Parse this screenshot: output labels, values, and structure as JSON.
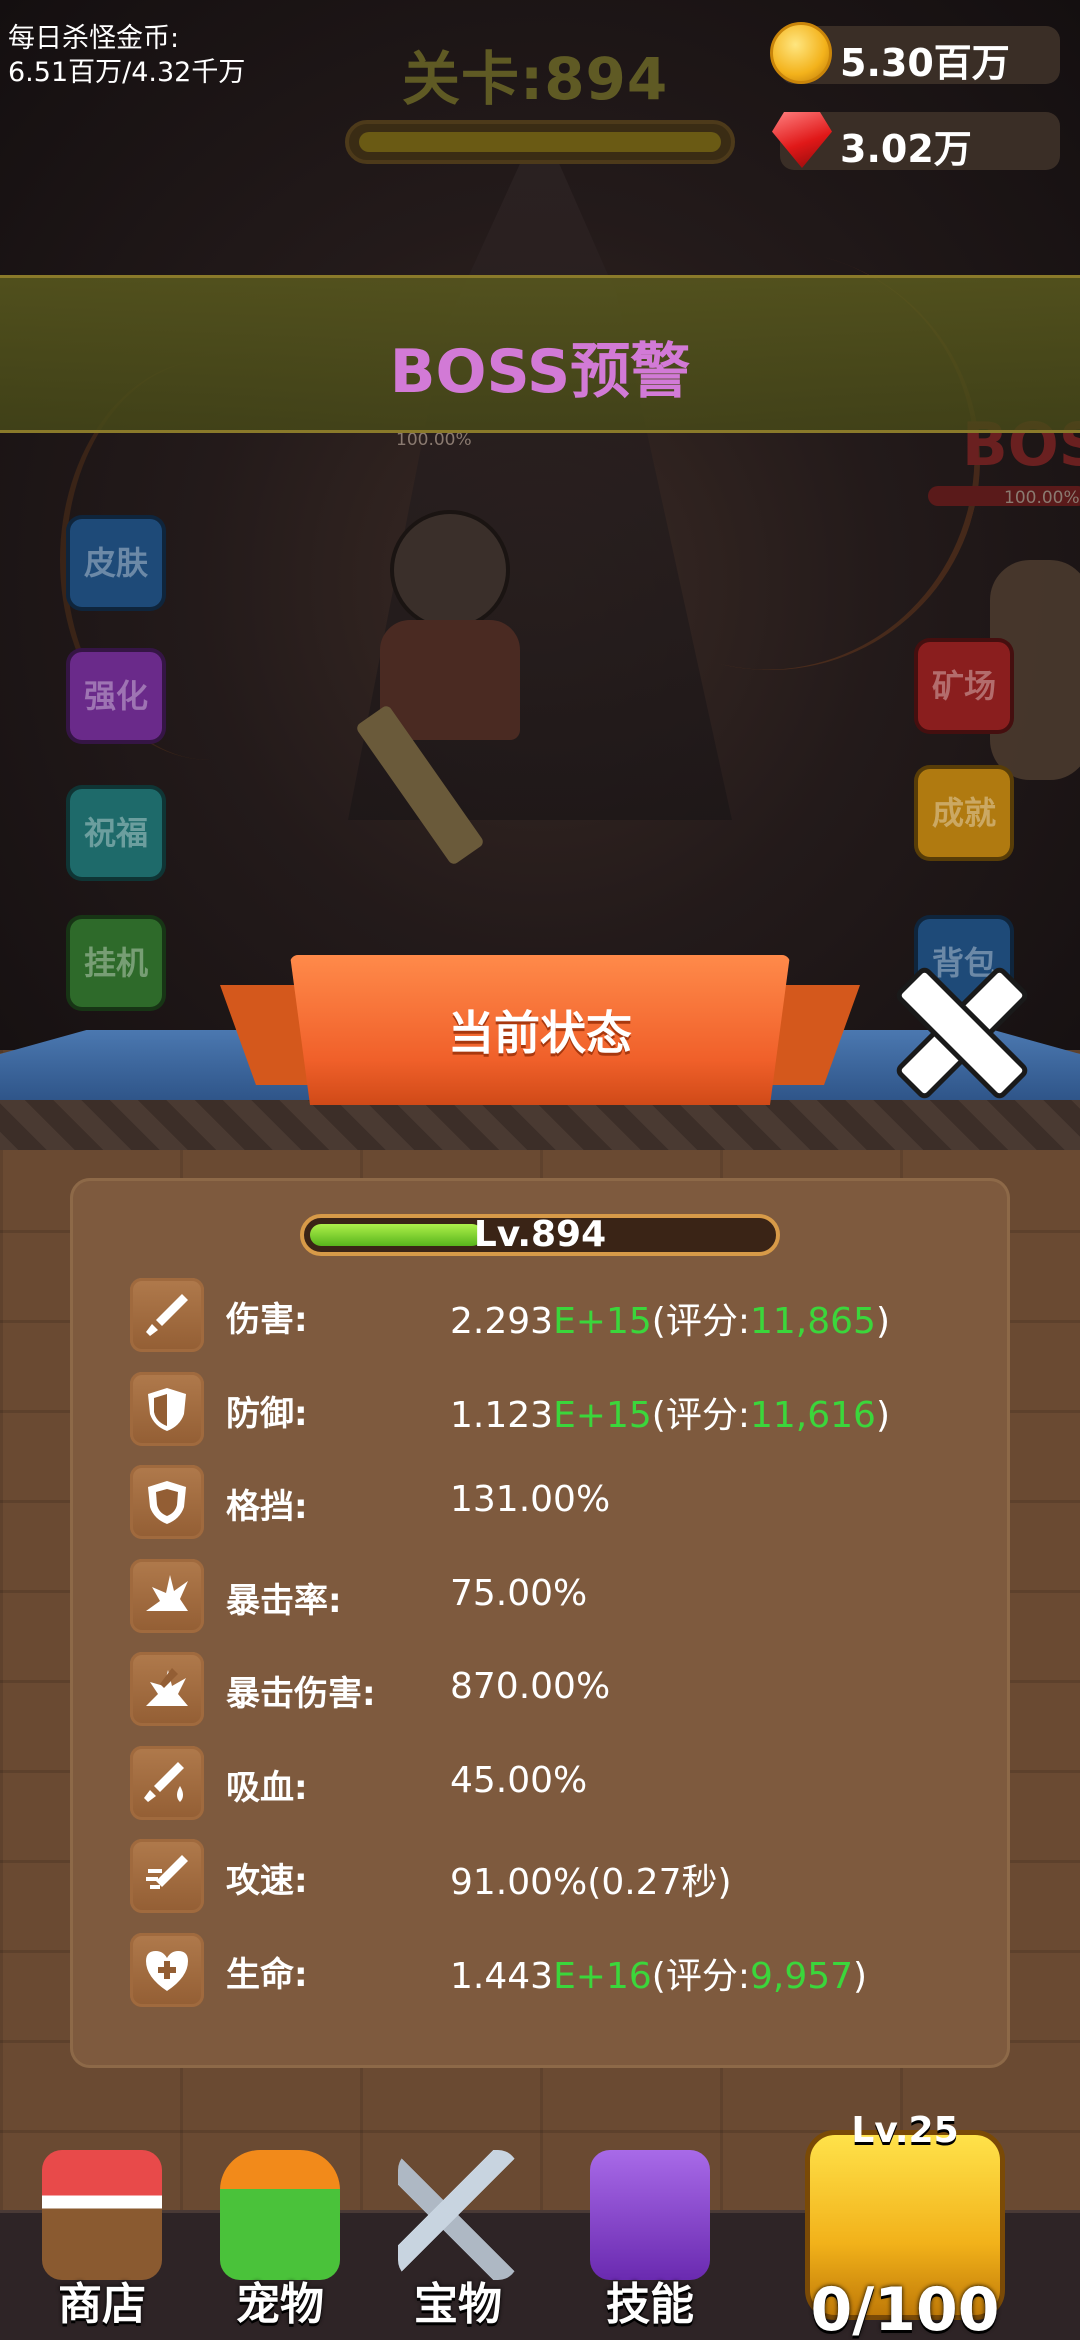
{
  "hud": {
    "daily_label": "每日杀怪金币:",
    "daily_value": "6.51百万/4.32千万",
    "level_title": "关卡:894",
    "coins": "5.30百万",
    "gems": "3.02万"
  },
  "boss_banner": "BOSS预警",
  "scene": {
    "hero_hp": "100.00%",
    "boss_label": "BOS",
    "boss_hp": "100.00%"
  },
  "side_left": [
    {
      "label": "皮肤",
      "color": "#1e4a78"
    },
    {
      "label": "强化",
      "color": "#6a2a8a"
    },
    {
      "label": "祝福",
      "color": "#1e6a6a"
    },
    {
      "label": "挂机",
      "color": "#2e6a2a"
    }
  ],
  "side_right": [
    {
      "label": "矿场",
      "color": "#8a1e1e"
    },
    {
      "label": "成就",
      "color": "#b07a10"
    },
    {
      "label": "背包",
      "color": "#1e4a78"
    }
  ],
  "panel": {
    "title": "当前状态",
    "level_text": "Lv.894",
    "level_progress": 0.37,
    "stats": [
      {
        "icon": "sword-icon",
        "label": "伤害:",
        "v1": "2.293",
        "g1": "E+15",
        "v2": "(评分:",
        "g2": "11,865",
        "v3": ")"
      },
      {
        "icon": "shield-icon",
        "label": "防御:",
        "v1": "1.123",
        "g1": "E+15",
        "v2": "(评分:",
        "g2": "11,616",
        "v3": ")"
      },
      {
        "icon": "block-shield-icon",
        "label": "格挡:",
        "v1": "131.00%"
      },
      {
        "icon": "crit-burst-icon",
        "label": "暴击率:",
        "v1": "75.00%"
      },
      {
        "icon": "crit-damage-icon",
        "label": "暴击伤害:",
        "v1": "870.00%"
      },
      {
        "icon": "lifesteal-icon",
        "label": "吸血:",
        "v1": "45.00%"
      },
      {
        "icon": "attack-speed-icon",
        "label": "攻速:",
        "v1": "91.00%(0.27秒)"
      },
      {
        "icon": "heart-cross-icon",
        "label": "生命:",
        "v1": "1.443",
        "g1": "E+16",
        "v2": "(评分:",
        "g2": "9,957",
        "v3": ")"
      }
    ]
  },
  "nav": {
    "shop": "商店",
    "pet": "宠物",
    "treasure": "宝物",
    "skill": "技能",
    "chest_level": "Lv.25",
    "chest_count": "0/100"
  }
}
